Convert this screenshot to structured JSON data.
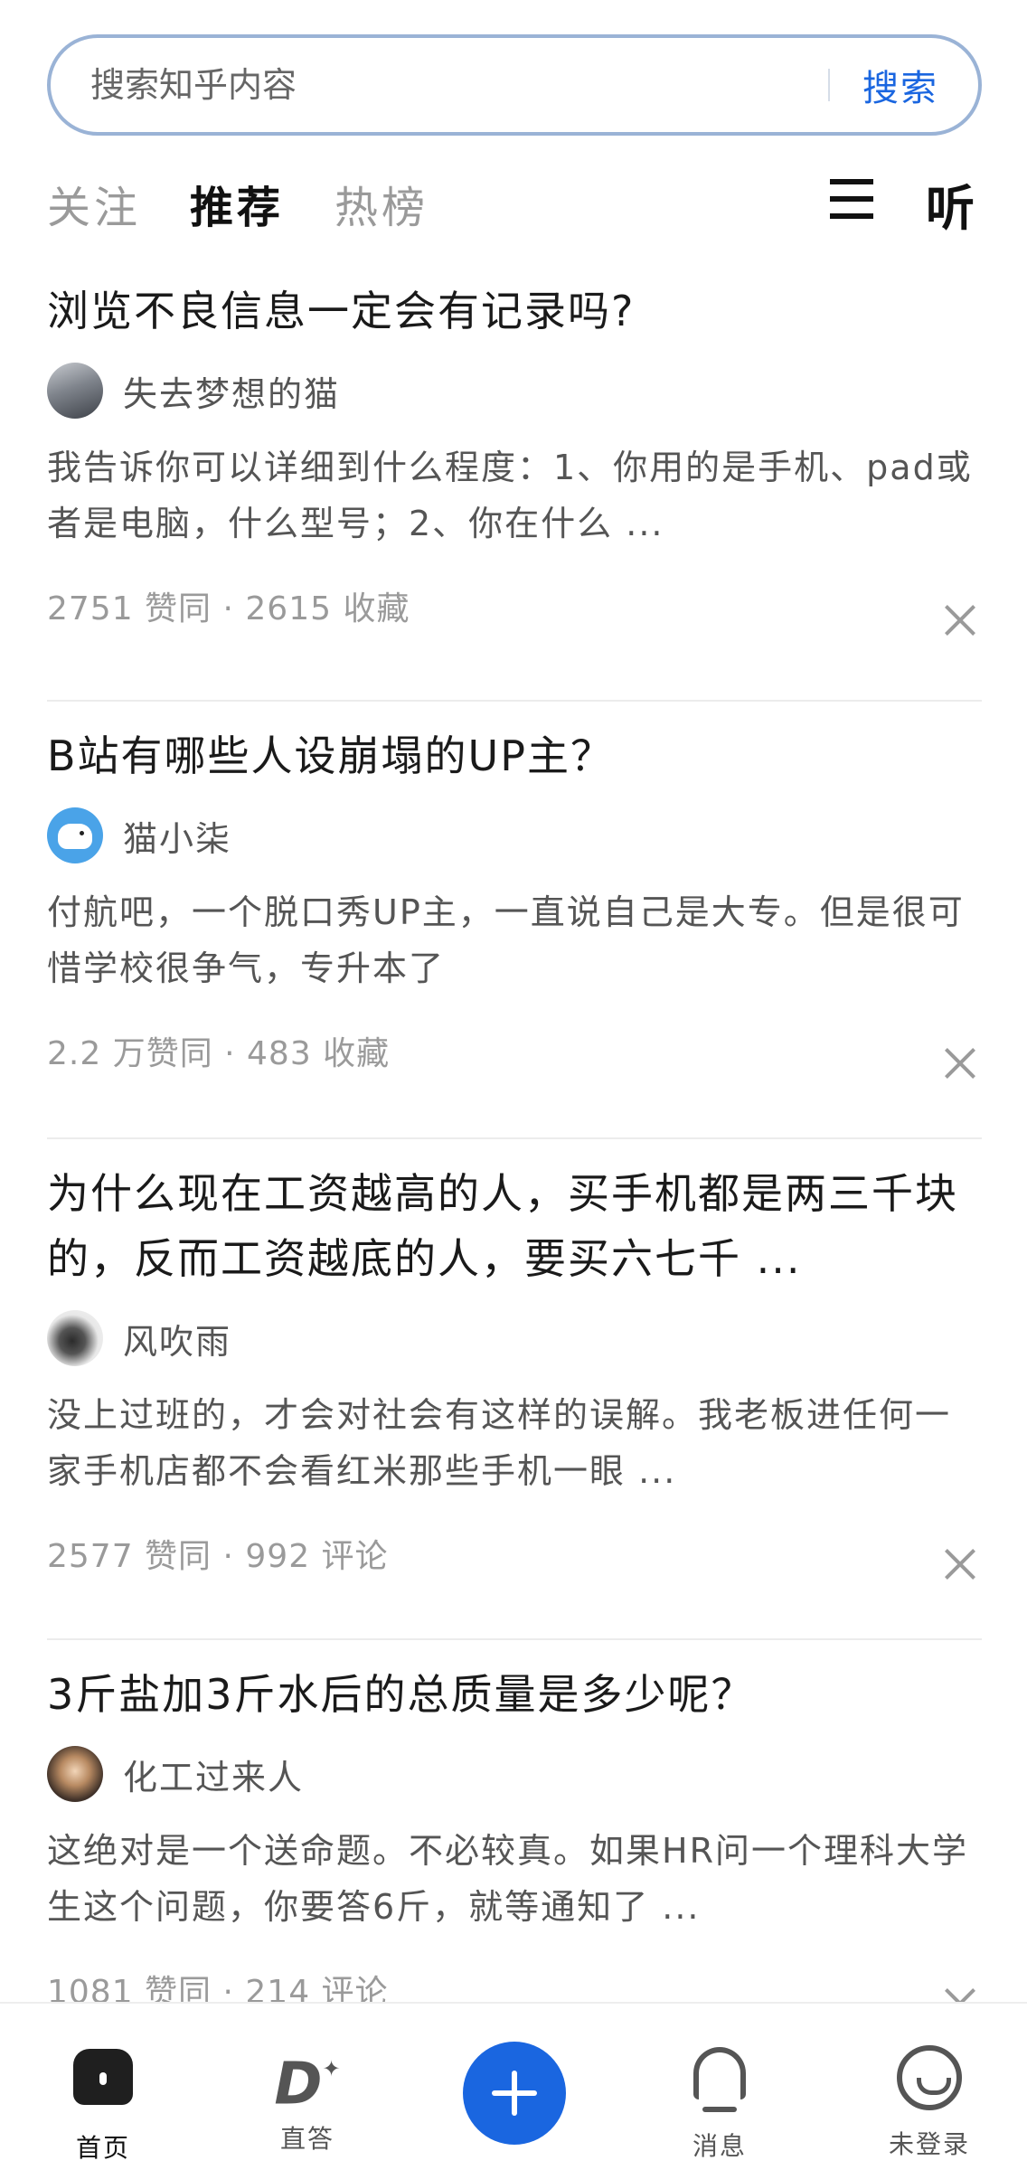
{
  "search": {
    "placeholder": "搜索知乎内容",
    "button_label": "搜索"
  },
  "tabs": [
    {
      "label": "关注",
      "active": false
    },
    {
      "label": "推荐",
      "active": true
    },
    {
      "label": "热榜",
      "active": false
    }
  ],
  "header_actions": {
    "menu_icon": "menu-icon",
    "listen_label": "听"
  },
  "feed": [
    {
      "title": "浏览不良信息一定会有记录吗?",
      "author": "失去梦想的猫",
      "excerpt": "我告诉你可以详细到什么程度：1、你用的是手机、pad或者是电脑，什么型号；2、你在什么 ...",
      "stats": "2751 赞同 · 2615 收藏"
    },
    {
      "title": "B站有哪些人设崩塌的UP主？",
      "author": "猫小柒",
      "excerpt": "付航吧，一个脱口秀UP主，一直说自己是大专。但是很可惜学校很争气，专升本了",
      "stats": "2.2 万赞同 · 483 收藏"
    },
    {
      "title": "为什么现在工资越高的人，买手机都是两三千块的，反而工资越底的人，要买六七千 ...",
      "author": "风吹雨",
      "excerpt": "没上过班的，才会对社会有这样的误解。我老板进任何一家手机店都不会看红米那些手机一眼 ...",
      "stats": "2577 赞同 · 992 评论"
    },
    {
      "title": "3斤盐加3斤水后的总质量是多少呢？",
      "author": "化工过来人",
      "excerpt": "这绝对是一个送命题。不必较真。如果HR问一个理科大学生这个问题，你要答6斤，就等通知了 ...",
      "stats": "1081 赞同 · 214 评论"
    }
  ],
  "bottom_nav": {
    "home": "首页",
    "zhida": "直答",
    "zhida_glyph": "D",
    "publish_icon": "plus-icon",
    "messages": "消息",
    "login": "未登录"
  },
  "colors": {
    "accent": "#1a66e0",
    "search_border": "#9ab3d6",
    "tab_highlight": "#bcd6f5",
    "muted_text": "#9a9a9a"
  }
}
